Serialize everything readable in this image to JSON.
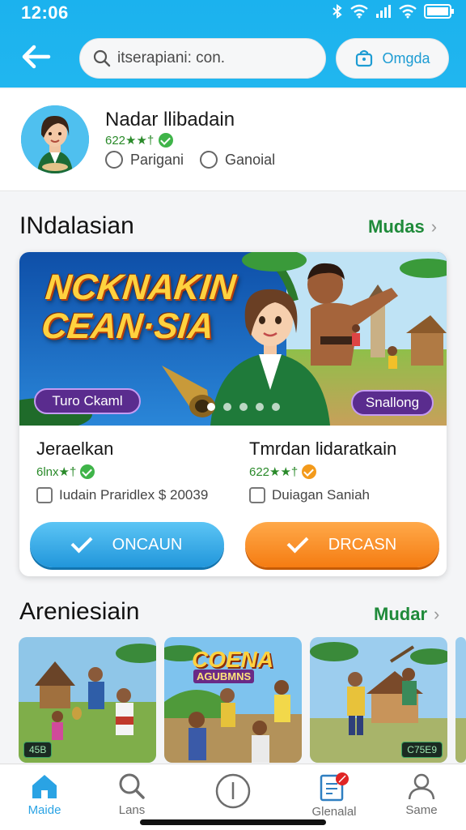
{
  "status": {
    "time": "12:06"
  },
  "header": {
    "search_text": "itserapiani: con.",
    "cart_label": "Omgda"
  },
  "profile": {
    "name": "Nadar llibadain",
    "rating": "622★★†",
    "options": [
      "Parigani",
      "Ganoial"
    ]
  },
  "section1": {
    "title": "INdalasian",
    "more": "Mudas"
  },
  "featured": {
    "banner_title_line1": "NCKNAKIN",
    "banner_title_line2": "CEAN·SIA",
    "left_pill": "Turo Ckaml",
    "right_pill": "Snallong",
    "games": [
      {
        "name": "Jeraelkan",
        "rating": "6lnx★†",
        "check_label": "Iudain Praridlex $ 20039",
        "button": "ONCAUN",
        "badge_color": "#3fb449"
      },
      {
        "name": "Tmrdan lidaratkain",
        "rating": "622★★†",
        "check_label": "Duiagan Saniah",
        "button": "DRCASN",
        "badge_color": "#f39a1b"
      }
    ]
  },
  "section2": {
    "title": "Areniesiain",
    "more": "Mudar"
  },
  "thumbs": [
    {
      "badge": "45B",
      "title": "",
      "sub": ""
    },
    {
      "badge": "",
      "title": "COENA",
      "sub": "AGUBMNS"
    },
    {
      "badge": "C75E9",
      "title": "",
      "sub": ""
    }
  ],
  "nav": {
    "items": [
      "Maide",
      "Lans",
      "",
      "Glenalal",
      "Same"
    ],
    "active": "Maide"
  },
  "colors": {
    "accent": "#21b6ef",
    "green": "#1f8a3a",
    "orange": "#f57c12"
  }
}
